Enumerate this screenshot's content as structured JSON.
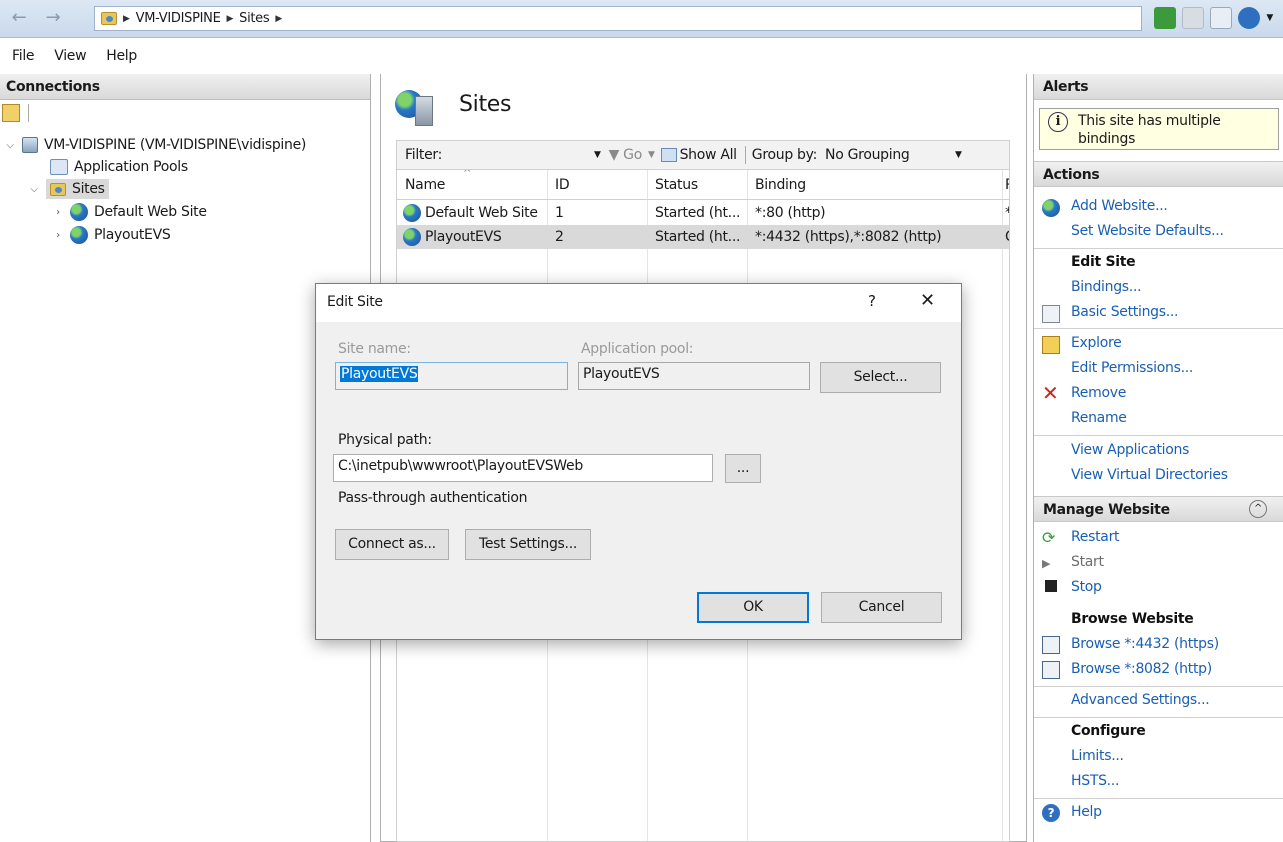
{
  "addressbar": {
    "crumbs": [
      "VM-VIDISPINE",
      "Sites"
    ]
  },
  "menu": [
    "File",
    "View",
    "Help"
  ],
  "connections": {
    "title": "Connections",
    "tree": {
      "server": "VM-VIDISPINE (VM-VIDISPINE\\vidispine)",
      "app_pools": "Application Pools",
      "sites": "Sites",
      "site1": "Default Web Site",
      "site2": "PlayoutEVS"
    }
  },
  "main": {
    "title": "Sites",
    "filter": {
      "label": "Filter:",
      "go": "Go",
      "show_all": "Show All",
      "group_by_label": "Group by:",
      "group_by_value": "No Grouping"
    },
    "columns": [
      "Name",
      "ID",
      "Status",
      "Binding",
      "P"
    ],
    "rows": [
      {
        "name": "Default Web Site",
        "id": "1",
        "status": "Started (ht...",
        "binding": "*:80 (http)",
        "extra": "*"
      },
      {
        "name": "PlayoutEVS",
        "id": "2",
        "status": "Started (ht...",
        "binding": "*:4432 (https),*:8082 (http)",
        "extra": "C"
      }
    ]
  },
  "dialog": {
    "title": "Edit Site",
    "help": "?",
    "close": "✕",
    "site_name_label": "Site name:",
    "site_name_value": "PlayoutEVS",
    "app_pool_label": "Application pool:",
    "app_pool_value": "PlayoutEVS",
    "select_button": "Select...",
    "physical_path_label": "Physical path:",
    "physical_path_value": "C:\\inetpub\\wwwroot\\PlayoutEVSWeb",
    "browse_button": "...",
    "passthrough": "Pass-through authentication",
    "connect_as": "Connect as...",
    "test_settings": "Test Settings...",
    "ok": "OK",
    "cancel": "Cancel"
  },
  "actions": {
    "alerts_title": "Alerts",
    "alert_text": "This site has multiple bindings",
    "actions_title": "Actions",
    "add_website": "Add Website...",
    "set_defaults": "Set Website Defaults...",
    "edit_site": "Edit Site",
    "bindings": "Bindings...",
    "basic_settings": "Basic Settings...",
    "explore": "Explore",
    "edit_permissions": "Edit Permissions...",
    "remove": "Remove",
    "rename": "Rename",
    "view_apps": "View Applications",
    "view_vdirs": "View Virtual Directories",
    "manage_title": "Manage Website",
    "restart": "Restart",
    "start": "Start",
    "stop": "Stop",
    "browse_title": "Browse Website",
    "browse_https": "Browse *:4432 (https)",
    "browse_http": "Browse *:8082 (http)",
    "advanced": "Advanced Settings...",
    "configure": "Configure",
    "limits": "Limits...",
    "hsts": "HSTS...",
    "help": "Help"
  }
}
